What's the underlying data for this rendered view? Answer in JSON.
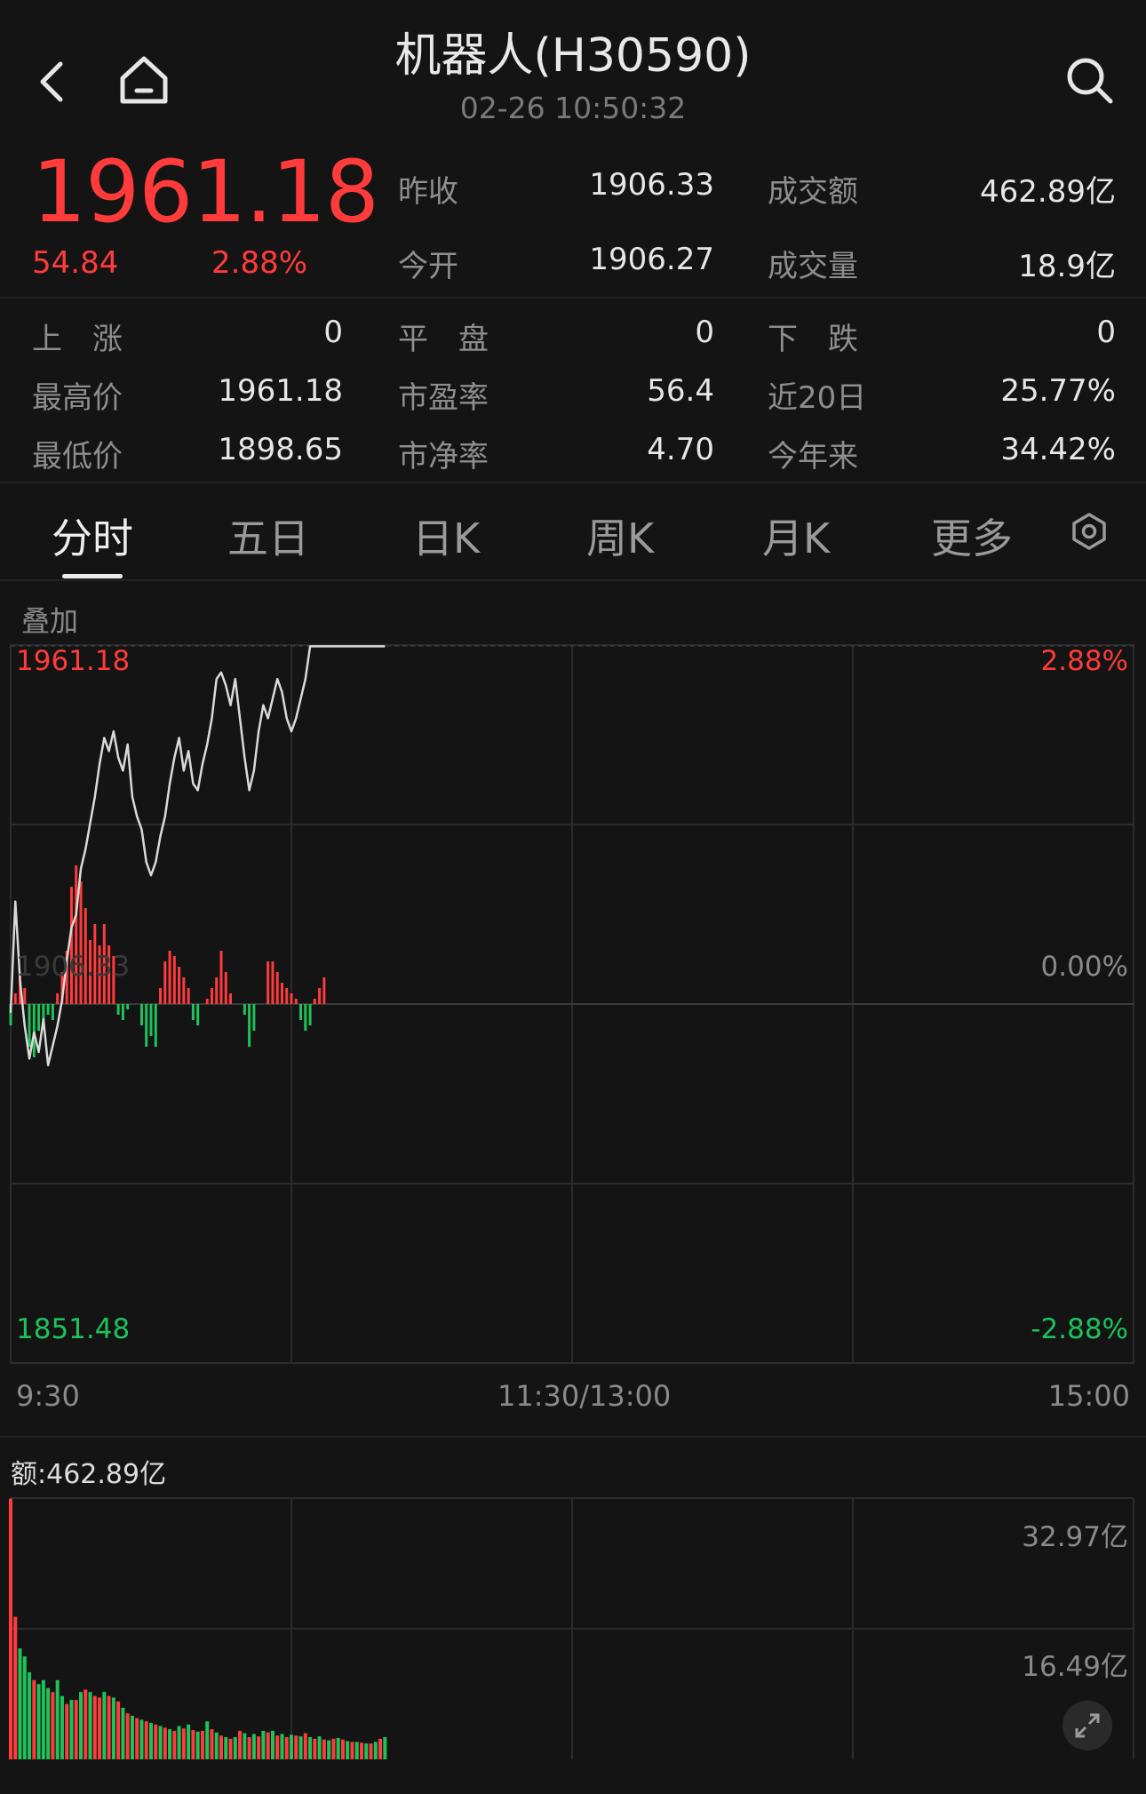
{
  "header": {
    "title": "机器人(H30590)",
    "timestamp": "02-26 10:50:32"
  },
  "price": {
    "last": "1961.18",
    "change": "54.84",
    "change_pct": "2.88%"
  },
  "quote_top": [
    {
      "label": "昨收",
      "value": "1906.33"
    },
    {
      "label": "成交额",
      "value": "462.89亿"
    },
    {
      "label": "今开",
      "value": "1906.27"
    },
    {
      "label": "成交量",
      "value": "18.9亿"
    }
  ],
  "quote_grid": [
    {
      "label": "上　涨",
      "value": "0"
    },
    {
      "label": "平　盘",
      "value": "0"
    },
    {
      "label": "下　跌",
      "value": "0"
    },
    {
      "label": "最高价",
      "value": "1961.18"
    },
    {
      "label": "市盈率",
      "value": "56.4"
    },
    {
      "label": "近20日",
      "value": "25.77%"
    },
    {
      "label": "最低价",
      "value": "1898.65"
    },
    {
      "label": "市净率",
      "value": "4.70"
    },
    {
      "label": "今年来",
      "value": "34.42%"
    }
  ],
  "tabs": [
    "分时",
    "五日",
    "日K",
    "周K",
    "月K",
    "更多"
  ],
  "active_tab": "分时",
  "overlay_label": "叠加",
  "colors": {
    "up": "#ff3b3b",
    "down": "#1ec25a",
    "line": "#d9d9d9",
    "background": "#141414"
  },
  "chart_data": [
    {
      "type": "line",
      "title": "",
      "y_labels_left": {
        "top": "1961.18",
        "mid": "1906.33",
        "bottom": "1851.48"
      },
      "y_labels_right": {
        "top": "2.88%",
        "mid": "0.00%",
        "bottom": "-2.88%"
      },
      "ylim": [
        1851.48,
        1961.18
      ],
      "x_labels": [
        "9:30",
        "11:30/13:00",
        "15:00"
      ],
      "x_range_minutes": [
        0,
        240
      ],
      "grid": true,
      "series": [
        {
          "x": [
            0,
            1,
            2,
            3,
            4,
            5,
            6,
            7,
            8,
            9,
            10,
            11,
            12,
            13,
            14,
            15,
            16,
            17,
            18,
            19,
            20,
            21,
            22,
            23,
            24,
            25,
            26,
            27,
            28,
            29,
            30,
            31,
            32,
            33,
            34,
            35,
            36,
            37,
            38,
            39,
            40,
            41,
            42,
            43,
            44,
            45,
            46,
            47,
            48,
            49,
            50,
            51,
            52,
            53,
            54,
            55,
            56,
            57,
            58,
            59,
            60,
            61,
            62,
            63,
            64,
            65,
            66,
            67,
            68,
            69,
            70,
            71,
            72,
            73,
            74,
            75,
            76,
            77,
            78,
            79,
            80
          ],
          "y": [
            1905,
            1922,
            1910,
            1903,
            1898,
            1902,
            1899,
            1904,
            1897,
            1900,
            1903,
            1907,
            1913,
            1918,
            1920,
            1927,
            1930,
            1934,
            1938,
            1943,
            1947,
            1945,
            1948,
            1944,
            1942,
            1946,
            1938,
            1935,
            1933,
            1928,
            1926,
            1928,
            1932,
            1935,
            1940,
            1944,
            1947,
            1942,
            1945,
            1940,
            1939,
            1943,
            1946,
            1950,
            1956,
            1957,
            1955,
            1952,
            1956,
            1950,
            1944,
            1939,
            1942,
            1948,
            1952,
            1950,
            1953,
            1956,
            1954,
            1950,
            1948,
            1950,
            1953,
            1956,
            1961,
            1961,
            1961,
            1961,
            1961,
            1961,
            1961,
            1961,
            1961,
            1961,
            1961,
            1961,
            1961,
            1961,
            1961,
            1961,
            1961
          ]
        }
      ],
      "histogram": {
        "x": [
          0,
          1,
          2,
          3,
          4,
          5,
          6,
          7,
          8,
          9,
          10,
          11,
          12,
          13,
          14,
          15,
          16,
          17,
          18,
          19,
          20,
          21,
          22,
          23,
          24,
          25,
          26,
          27,
          28,
          29,
          30,
          31,
          32,
          33,
          34,
          35,
          36,
          37,
          38,
          39,
          40,
          41,
          42,
          43,
          44,
          45,
          46,
          47,
          48,
          49,
          50,
          51,
          52,
          53,
          54,
          55,
          56,
          57,
          58,
          59,
          60,
          61,
          62,
          63,
          64,
          65,
          66,
          67,
          68,
          69,
          70,
          71,
          72,
          73,
          74,
          75,
          76,
          77,
          78,
          79,
          80
        ],
        "values": [
          -0.4,
          0.2,
          0.6,
          0.3,
          -0.8,
          -1.0,
          -0.5,
          -0.4,
          -0.2,
          -0.3,
          0.2,
          0.6,
          1.0,
          2.2,
          2.6,
          2.3,
          1.8,
          1.2,
          1.5,
          1.1,
          1.5,
          1.1,
          0.9,
          -0.2,
          -0.3,
          -0.1,
          0,
          0,
          -0.4,
          -0.8,
          -0.6,
          -0.8,
          0.3,
          0.8,
          1.0,
          0.9,
          0.7,
          0.5,
          0.3,
          -0.3,
          -0.4,
          0,
          0.1,
          0.3,
          0.5,
          1.0,
          0.6,
          0.2,
          0,
          0,
          -0.2,
          -0.8,
          -0.5,
          0,
          0,
          0.8,
          0.8,
          0.6,
          0.4,
          0.3,
          0.2,
          0.1,
          -0.3,
          -0.5,
          -0.4,
          0.1,
          0.3,
          0.5,
          0,
          0,
          0,
          0,
          0,
          0,
          0,
          0,
          0,
          0,
          0,
          0,
          0
        ]
      }
    },
    {
      "type": "bar",
      "title": "额:462.89亿",
      "y_labels_right": [
        "32.97亿",
        "16.49亿"
      ],
      "ylim": [
        0,
        32.97
      ],
      "x_range_minutes": [
        0,
        240
      ],
      "values": [
        32.9,
        18,
        14,
        13,
        11,
        10,
        9.5,
        10,
        9,
        8.5,
        10,
        8,
        7,
        7.5,
        7.5,
        8.5,
        8.8,
        8.5,
        8,
        7.8,
        8.5,
        8,
        7.8,
        7.3,
        6.5,
        5.8,
        5.5,
        5.2,
        5,
        4.8,
        4.6,
        4.4,
        4.2,
        4.0,
        3.8,
        3.6,
        4.2,
        3.9,
        4.4,
        3.7,
        3.5,
        3.6,
        4.8,
        3.8,
        3.4,
        3.0,
        2.8,
        2.6,
        2.8,
        3.6,
        3.3,
        2.8,
        3.2,
        2.9,
        3.6,
        3.4,
        3.6,
        3.0,
        3.2,
        2.8,
        3.1,
        3.0,
        2.9,
        3.3,
        2.8,
        2.6,
        2.9,
        2.5,
        2.4,
        2.6,
        2.7,
        2.5,
        2.3,
        2.2,
        2.2,
        2.1,
        2.0,
        2.0,
        2.2,
        2.6,
        2.8
      ],
      "colors": [
        "up",
        "up",
        "down",
        "down",
        "down",
        "up",
        "down",
        "down",
        "down",
        "up",
        "down",
        "down",
        "up",
        "down",
        "up",
        "down",
        "up",
        "down",
        "up",
        "up",
        "down",
        "up",
        "down",
        "up",
        "down",
        "up",
        "down",
        "up",
        "down",
        "up",
        "down",
        "up",
        "down",
        "up",
        "down",
        "up",
        "down",
        "up",
        "down",
        "up",
        "down",
        "up",
        "down",
        "up",
        "down",
        "up",
        "down",
        "up",
        "down",
        "up",
        "down",
        "up",
        "down",
        "up",
        "down",
        "up",
        "down",
        "up",
        "down",
        "up",
        "down",
        "up",
        "down",
        "up",
        "down",
        "up",
        "down",
        "up",
        "down",
        "up",
        "down",
        "up",
        "down",
        "up",
        "down",
        "up",
        "down",
        "up",
        "down",
        "up",
        "down"
      ]
    }
  ]
}
